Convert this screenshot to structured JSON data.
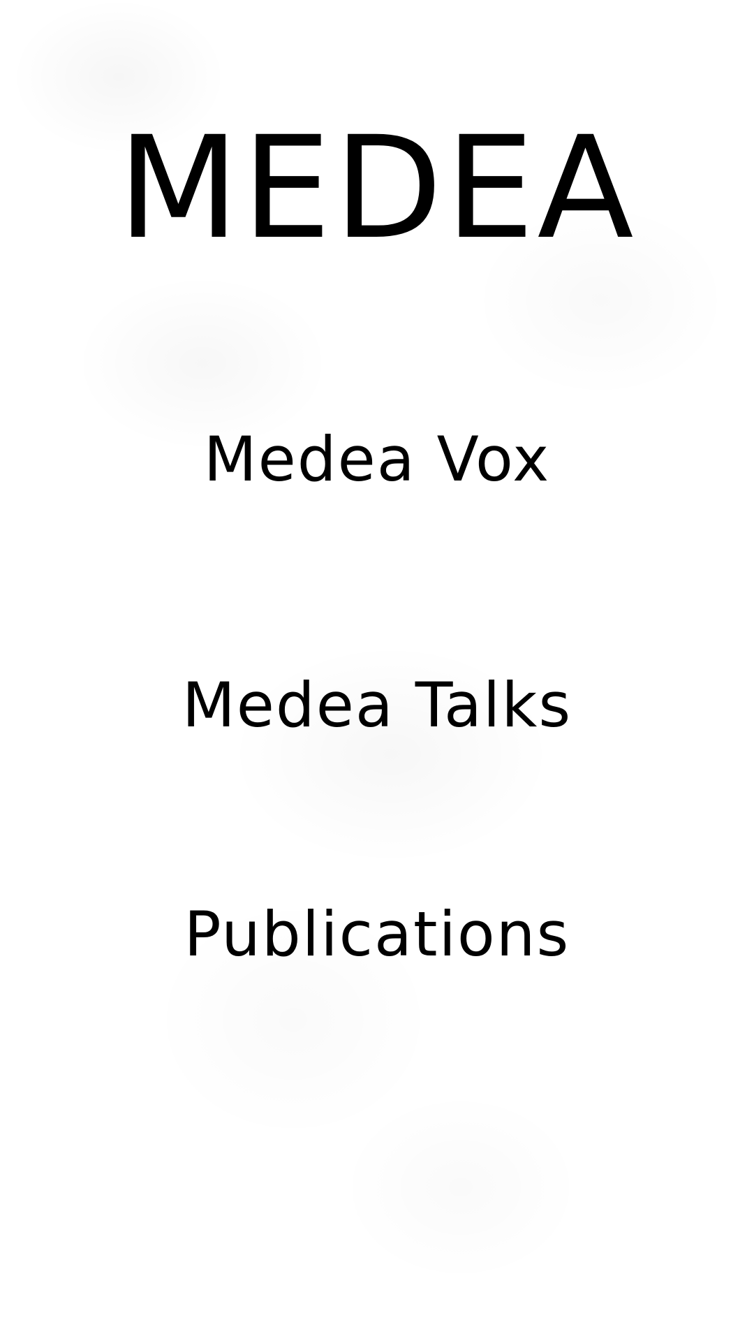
{
  "brand": {
    "title": "MEDEA"
  },
  "menu": {
    "items": [
      {
        "label": "Medea Vox"
      },
      {
        "label": "Medea Talks"
      },
      {
        "label": "Publications"
      }
    ]
  },
  "colors": {
    "background": "#ffffff",
    "text": "#000000"
  }
}
